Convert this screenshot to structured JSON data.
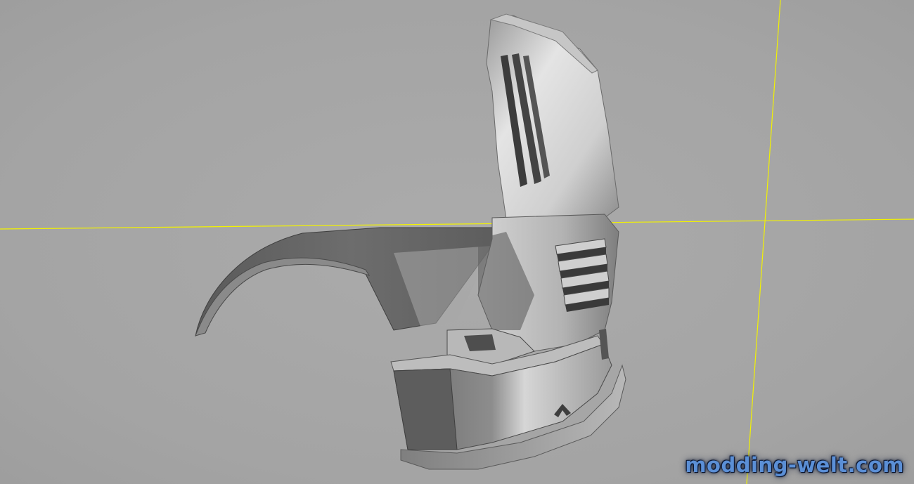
{
  "viewport": {
    "background_color": "#a6a6a6",
    "axis_color": "#f2f200",
    "model": {
      "label": "",
      "shade_dark": "#4a4a4a",
      "shade_mid": "#7a7a7a",
      "shade_light": "#d8d8d8"
    }
  },
  "watermark": {
    "text": "modding-welt.com",
    "color": "#5b8fd6"
  }
}
